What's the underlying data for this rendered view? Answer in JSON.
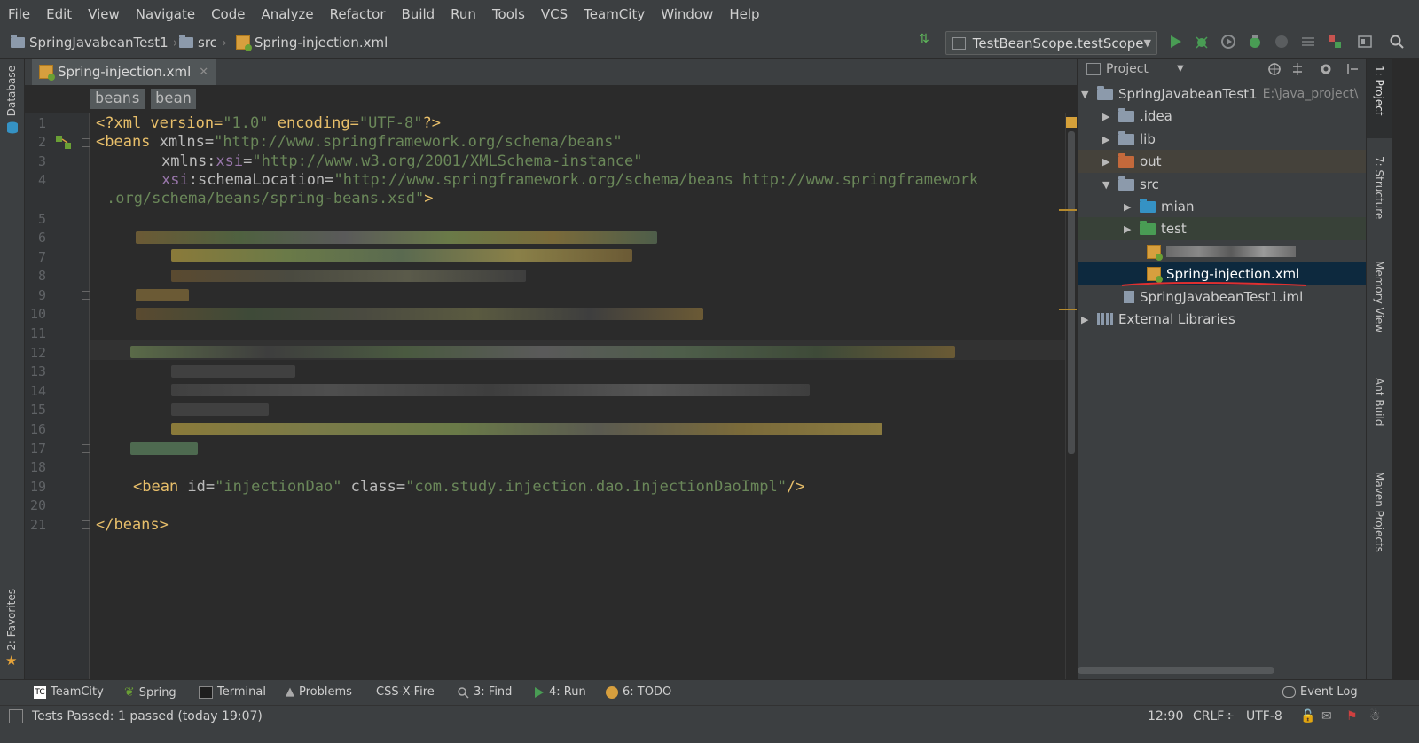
{
  "menu": [
    "File",
    "Edit",
    "View",
    "Navigate",
    "Code",
    "Analyze",
    "Refactor",
    "Build",
    "Run",
    "Tools",
    "VCS",
    "TeamCity",
    "Window",
    "Help"
  ],
  "toolbar": {
    "crumbs": [
      "SpringJavabeanTest1",
      "src",
      "Spring-injection.xml"
    ],
    "run_config": "TestBeanScope.testScope"
  },
  "left_strip": {
    "database": "Database",
    "favorites": "2: Favorites"
  },
  "editor": {
    "tab_title": "Spring-injection.xml",
    "tag_breadcrumbs": [
      "beans",
      "bean"
    ],
    "line_numbers": [
      "1",
      "2",
      "3",
      "4",
      "5",
      "6",
      "7",
      "8",
      "9",
      "10",
      "11",
      "12",
      "13",
      "14",
      "15",
      "16",
      "17",
      "18",
      "19",
      "20",
      "21"
    ],
    "code": {
      "l1": {
        "a": "<?xml version=",
        "b": "\"1.0\"",
        "c": " encoding=",
        "d": "\"UTF-8\"",
        "e": "?>"
      },
      "l2": {
        "a": "<beans ",
        "b": "xmlns=",
        "c": "\"http://www.springframework.org/schema/beans\""
      },
      "l3": {
        "a": "xmlns:",
        "b": "xsi",
        "c": "=",
        "d": "\"http://www.w3.org/2001/XMLSchema-instance\""
      },
      "l4": {
        "a": "xsi",
        "b": ":schemaLocation=",
        "c": "\"http://www.springframework.org/schema/beans http://www.springframework"
      },
      "l4b": ".org/schema/beans/spring-beans.xsd\"",
      "l4c": ">",
      "l19": {
        "a": "<bean ",
        "b": "id=",
        "c": "\"injectionDao\"",
        "d": " class=",
        "e": "\"com.study.injection.dao.InjectionDaoImpl\"",
        "f": "/>"
      },
      "l21": "</beans>"
    }
  },
  "project": {
    "header": "Project",
    "tree": [
      {
        "label": "SpringJavabeanTest1",
        "path": "E:\\java_project\\"
      },
      {
        "label": ".idea"
      },
      {
        "label": "lib"
      },
      {
        "label": "out"
      },
      {
        "label": "src"
      },
      {
        "label": "mian"
      },
      {
        "label": "test"
      },
      {
        "label": "Spring-injection.xml"
      },
      {
        "label": "SpringJavabeanTest1.iml"
      },
      {
        "label": "External Libraries"
      }
    ]
  },
  "right_strip": [
    "1: Project",
    "7: Structure",
    "Memory View",
    "Ant Build",
    "Maven Projects"
  ],
  "bottom_tools": [
    "TeamCity",
    "Spring",
    "Terminal",
    "Problems",
    "CSS-X-Fire",
    "3: Find",
    "4: Run",
    "6: TODO",
    "Event Log"
  ],
  "status": {
    "message": "Tests Passed: 1 passed (today 19:07)",
    "position": "12:90",
    "line_sep": "CRLF÷",
    "encoding": "UTF-8"
  },
  "colors": {
    "accent_green": "#499c54",
    "selection": "#0d293e",
    "tag": "#e8bf6a",
    "string": "#6a8759"
  }
}
